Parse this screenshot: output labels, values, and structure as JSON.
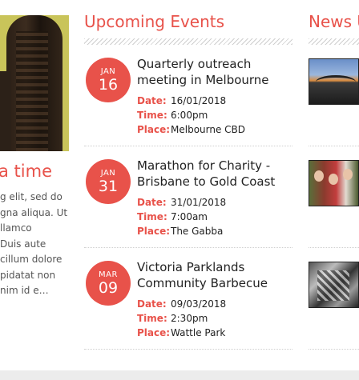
{
  "left_column": {
    "title": "a time",
    "text_lines": [
      "g elit, sed do",
      "gna aliqua. Ut",
      "llamco",
      "Duis aute",
      "cillum dolore",
      "pidatat non",
      "nim id e…"
    ]
  },
  "events": {
    "heading": "Upcoming Events",
    "labels": {
      "date": "Date:",
      "time": "Time:",
      "place": "Place:"
    },
    "items": [
      {
        "month": "JAN",
        "day": "16",
        "title_lines": [
          "Quarterly outreach",
          "meeting in Melbourne"
        ],
        "date": "16/01/2018",
        "time": "6:00pm",
        "place": "Melbourne CBD"
      },
      {
        "month": "JAN",
        "day": "31",
        "title_lines": [
          "Marathon for Charity -",
          "Brisbane to Gold Coast"
        ],
        "date": "31/01/2018",
        "time": "7:00am",
        "place": "The Gabba"
      },
      {
        "month": "MAR",
        "day": "09",
        "title_lines": [
          "Victoria Parklands",
          "Community Barbecue"
        ],
        "date": "09/03/2018",
        "time": "2:30pm",
        "place": "Wattle Park"
      }
    ]
  },
  "news": {
    "heading": "News U"
  },
  "colors": {
    "accent": "#e8524a",
    "text": "#222222",
    "muted": "#555555",
    "footer": "#ececec"
  }
}
